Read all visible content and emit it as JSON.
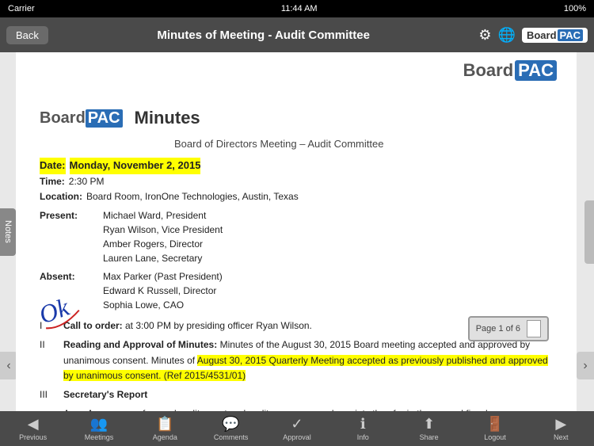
{
  "statusBar": {
    "carrier": "Carrier",
    "time": "11:44 AM",
    "battery": "100%"
  },
  "navBar": {
    "backLabel": "Back",
    "title": "Minutes of Meeting - Audit Committee",
    "settingsIcon": "⚙",
    "globeIcon": "🌐",
    "logoBoard": "Board",
    "logoPac": "PAC"
  },
  "notesTab": {
    "label": "Notes"
  },
  "document": {
    "topLogo": {
      "board": "Board",
      "pac": "PAC"
    },
    "inlineLogo": {
      "board": "Board",
      "pac": "PAC"
    },
    "title": "Minutes",
    "subtitle": "Board of Directors Meeting – Audit Committee",
    "dateLabel": "Date:",
    "dateValue": "Monday, November 2, 2015",
    "timeLabel": "Time:",
    "timeValue": "2:30 PM",
    "locationLabel": "Location:",
    "locationValue": "Board Room, IronOne Technologies, Austin, Texas",
    "presentLabel": "Present:",
    "presentNames": [
      "Michael Ward, President",
      "Ryan Wilson, Vice President",
      "Amber Rogers, Director",
      "Lauren Lane, Secretary"
    ],
    "absentLabel": "Absent:",
    "absentNames": [
      "Max Parker (Past President)",
      "Edward K Russell, Director",
      "Sophia Lowe, CAO"
    ],
    "sections": [
      {
        "num": "I",
        "bold": "Call to order:",
        "text": " at 3:00 PM by presiding officer Ryan Wilson."
      },
      {
        "num": "II",
        "bold": "Reading and Approval of Minutes:",
        "text": " Minutes of the August 30, 2015 Board meeting accepted and approved by unanimous consent. Minutes of ",
        "highlight": "August 30, 2015 Quarterly Meeting accepted as previously published and approved by unanimous consent. (Ref 2015/4531/01)",
        "textAfter": ""
      },
      {
        "num": "III",
        "bold": "Secretary's Report",
        "text": ""
      },
      {
        "num": "A.",
        "bold": "",
        "text": "A summary of annual audit report and audit responses and receipts thus far in the second fiscal quarter was reviewed."
      }
    ]
  },
  "pageBadge": {
    "label": "Page 1 of 6"
  },
  "handwritten": {
    "text": "Ok"
  },
  "toolbar": {
    "items": [
      {
        "icon": "◀",
        "label": "Previous"
      },
      {
        "icon": "👥",
        "label": "Meetings"
      },
      {
        "icon": "📋",
        "label": "Agenda"
      },
      {
        "icon": "💬",
        "label": "Comments"
      },
      {
        "icon": "✓",
        "label": "Approval"
      },
      {
        "icon": "ℹ",
        "label": "Info"
      },
      {
        "icon": "↑",
        "label": "Share"
      },
      {
        "icon": "🚪",
        "label": "Logout"
      },
      {
        "icon": "▶",
        "label": "Next"
      }
    ]
  }
}
